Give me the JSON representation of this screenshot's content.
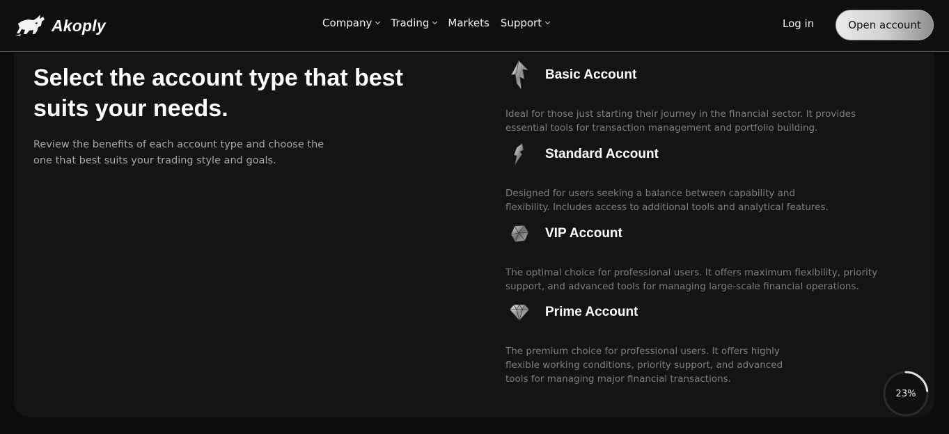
{
  "brand": {
    "name": "Akoply",
    "logo_icon": "bull-icon"
  },
  "nav": {
    "items": [
      {
        "label": "Company",
        "has_dropdown": true
      },
      {
        "label": "Trading",
        "has_dropdown": true
      },
      {
        "label": "Markets",
        "has_dropdown": false
      },
      {
        "label": "Support",
        "has_dropdown": true
      }
    ]
  },
  "header": {
    "login_label": "Log in",
    "open_account_label": "Open account"
  },
  "hero": {
    "title": "Select the account type that best suits your needs.",
    "description": "Review the benefits of each account type and choose the one that best suits your trading style and goals."
  },
  "accounts": [
    {
      "icon": "arrow-up-icon",
      "title": "Basic Account",
      "description": "Ideal for those just starting their journey in the financial sector. It provides essential tools for transaction management and portfolio building."
    },
    {
      "icon": "lightning-icon",
      "title": "Standard Account",
      "description": "Designed for users seeking a balance between capability and flexibility. Includes access to additional tools and analytical features."
    },
    {
      "icon": "gem-icon",
      "title": "VIP Account",
      "description": "The optimal choice for professional users. It offers maximum flexibility, priority support, and advanced tools for managing large-scale financial operations."
    },
    {
      "icon": "diamond-icon",
      "title": "Prime Account",
      "description": "The premium choice for professional users. It offers highly flexible working conditions, priority support, and advanced tools for managing major financial transactions."
    }
  ],
  "scroll_progress": {
    "label": "23%",
    "value": 23
  },
  "colors": {
    "background": "#0c0c0c",
    "card": "#141414",
    "muted_text": "#7e7e7e",
    "button_light": "#d8d8d8"
  }
}
